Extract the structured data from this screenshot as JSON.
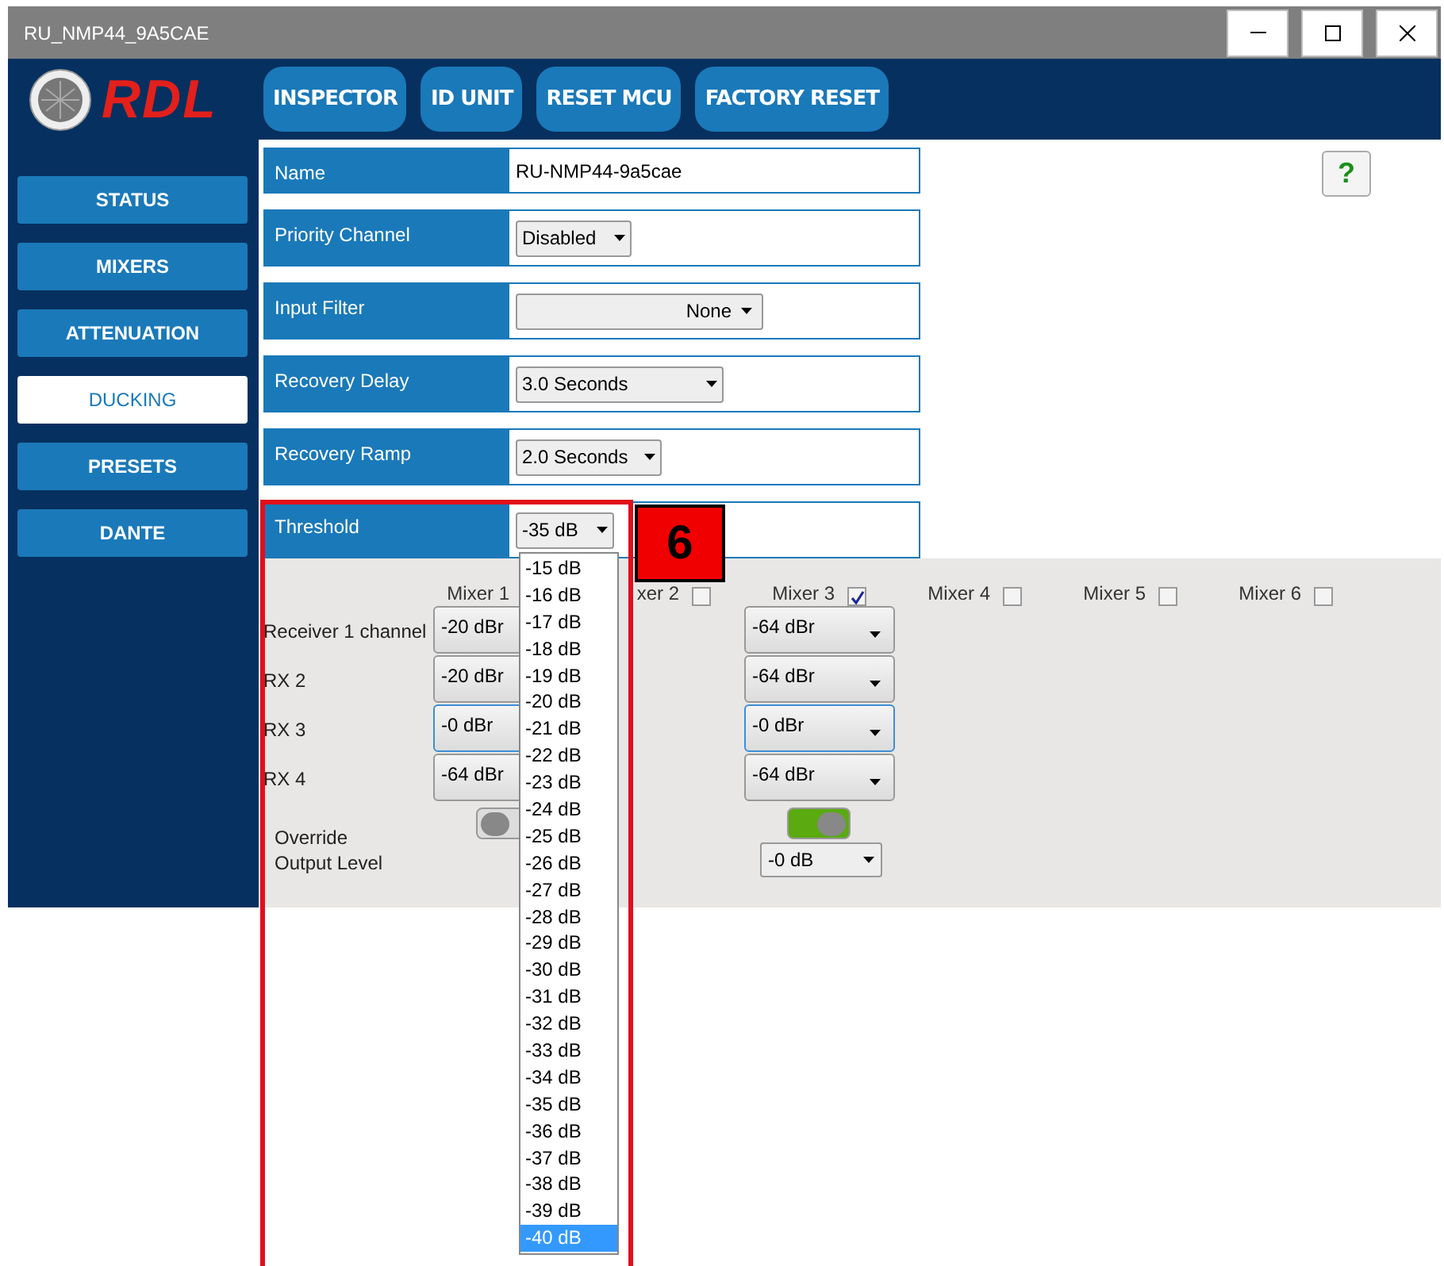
{
  "window": {
    "title": "RU_NMP44_9A5CAE"
  },
  "logo": {
    "text": "RDL"
  },
  "toolbar_buttons": [
    "INSPECTOR",
    "ID UNIT",
    "RESET MCU",
    "FACTORY RESET"
  ],
  "sidebar": {
    "items": [
      {
        "label": "STATUS",
        "selected": false
      },
      {
        "label": "MIXERS",
        "selected": false
      },
      {
        "label": "ATTENUATION",
        "selected": false
      },
      {
        "label": "DUCKING",
        "selected": true
      },
      {
        "label": "PRESETS",
        "selected": false
      },
      {
        "label": "DANTE",
        "selected": false
      }
    ]
  },
  "form": {
    "rows": [
      {
        "label": "Name",
        "kind": "text",
        "value": "RU-NMP44-9a5cae"
      },
      {
        "label": "Priority Channel",
        "kind": "select",
        "value": "Disabled"
      },
      {
        "label": "Input Filter",
        "kind": "select",
        "value": "None"
      },
      {
        "label": "Recovery Delay",
        "kind": "select",
        "value": "3.0 Seconds"
      },
      {
        "label": "Recovery Ramp",
        "kind": "select",
        "value": "2.0 Seconds"
      },
      {
        "label": "Threshold",
        "kind": "select",
        "value": "-35 dB",
        "expanded": true
      }
    ]
  },
  "help_button": {
    "label": "?"
  },
  "threshold_options": [
    {
      "label": "-15 dB",
      "selected": false
    },
    {
      "label": "-16 dB",
      "selected": false
    },
    {
      "label": "-17 dB",
      "selected": false
    },
    {
      "label": "-18 dB",
      "selected": false
    },
    {
      "label": "-19 dB",
      "selected": false
    },
    {
      "label": "-20 dB",
      "selected": false
    },
    {
      "label": "-21 dB",
      "selected": false
    },
    {
      "label": "-22 dB",
      "selected": false
    },
    {
      "label": "-23 dB",
      "selected": false
    },
    {
      "label": "-24 dB",
      "selected": false
    },
    {
      "label": "-25 dB",
      "selected": false
    },
    {
      "label": "-26 dB",
      "selected": false
    },
    {
      "label": "-27 dB",
      "selected": false
    },
    {
      "label": "-28 dB",
      "selected": false
    },
    {
      "label": "-29 dB",
      "selected": false
    },
    {
      "label": "-30 dB",
      "selected": false
    },
    {
      "label": "-31 dB",
      "selected": false
    },
    {
      "label": "-32 dB",
      "selected": false
    },
    {
      "label": "-33 dB",
      "selected": false
    },
    {
      "label": "-34 dB",
      "selected": false
    },
    {
      "label": "-35 dB",
      "selected": false
    },
    {
      "label": "-36 dB",
      "selected": false
    },
    {
      "label": "-37 dB",
      "selected": false
    },
    {
      "label": "-38 dB",
      "selected": false
    },
    {
      "label": "-39 dB",
      "selected": false
    },
    {
      "label": "-40 dB",
      "selected": true
    }
  ],
  "channel_labels": [
    "Receiver 1 channel",
    "RX 2",
    "RX 3",
    "RX 4"
  ],
  "override_label": "Override Output Level",
  "mixers": [
    {
      "label": "Mixer 1",
      "levels": [
        {
          "value": "-20 dBr",
          "focused": false
        },
        {
          "value": "-20 dBr",
          "focused": false
        },
        {
          "value": "-0 dBr",
          "focused": true
        },
        {
          "value": "-64 dBr",
          "focused": false
        }
      ],
      "override_on": false
    },
    {
      "label": "xer 2",
      "checked": false
    },
    {
      "label": "Mixer 3",
      "checked": true,
      "levels": [
        {
          "value": "-64 dBr",
          "focused": false
        },
        {
          "value": "-64 dBr",
          "focused": false
        },
        {
          "value": "-0 dBr",
          "focused": true
        },
        {
          "value": "-64 dBr",
          "focused": false
        }
      ],
      "override_on": true,
      "output_level": "-0 dB"
    },
    {
      "label": "Mixer 4",
      "checked": false
    },
    {
      "label": "Mixer 5",
      "checked": false
    },
    {
      "label": "Mixer 6",
      "checked": false
    }
  ],
  "annotation": {
    "label": "6"
  }
}
